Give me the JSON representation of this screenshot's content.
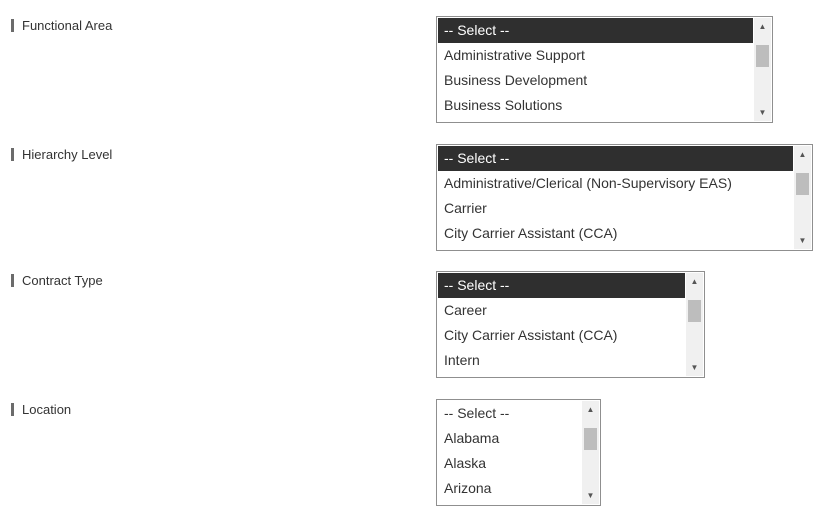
{
  "fields": [
    {
      "label": "Functional Area",
      "options": [
        "-- Select --",
        "Administrative Support",
        "Business Development",
        "Business Solutions"
      ],
      "selected_index": 0
    },
    {
      "label": "Hierarchy Level",
      "options": [
        "-- Select --",
        "Administrative/Clerical (Non-Supervisory EAS)",
        "Carrier",
        "City Carrier Assistant (CCA)"
      ],
      "selected_index": 0
    },
    {
      "label": "Contract Type",
      "options": [
        "-- Select --",
        "Career",
        "City Carrier Assistant (CCA)",
        "Intern"
      ],
      "selected_index": 0
    },
    {
      "label": "Location",
      "options": [
        "-- Select --",
        "Alabama",
        "Alaska",
        "Arizona"
      ],
      "selected_index": null
    }
  ],
  "icons": {
    "scroll_up": "scroll-up-arrow-icon",
    "scroll_down": "scroll-down-arrow-icon"
  },
  "colors": {
    "selected_bg": "#2f2f2f",
    "selected_text": "#ffffff",
    "label_bar": "#6b6b6b"
  }
}
